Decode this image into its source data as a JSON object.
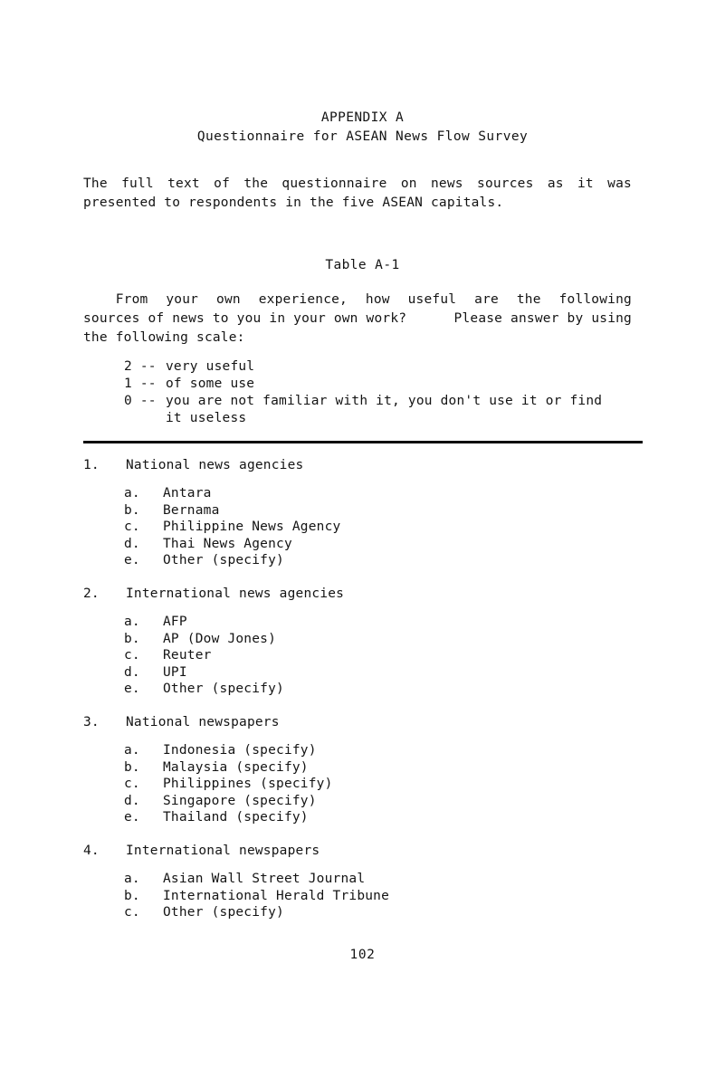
{
  "document": {
    "appendix_title": "APPENDIX A",
    "appendix_subtitle": "Questionnaire for ASEAN News Flow Survey",
    "intro": {
      "line1_words": [
        "The",
        "full",
        "text",
        "of",
        "the",
        "questionnaire",
        "on",
        "news",
        "sources",
        "as",
        "it",
        "was"
      ],
      "line2": "presented to respondents in the five ASEAN capitals."
    },
    "table_heading": "Table A-1",
    "prompt": {
      "line1_words": [
        "From",
        "your",
        "own",
        "experience,",
        "how",
        "useful",
        "are",
        "the",
        "following"
      ],
      "line2_words": [
        "sources of news to you in your own work?",
        "Please answer by using"
      ],
      "line3": "the following scale:"
    },
    "scale": [
      {
        "key": "2 --",
        "text": "very useful"
      },
      {
        "key": "1 --",
        "text": "of some use"
      },
      {
        "key": "0 --",
        "text": "you are not familiar with it, you don't use it or find",
        "continuation": "it useless"
      }
    ],
    "questions": [
      {
        "number": "1.",
        "title": "National news agencies",
        "items": [
          {
            "letter": "a.",
            "label": "Antara"
          },
          {
            "letter": "b.",
            "label": "Bernama"
          },
          {
            "letter": "c.",
            "label": "Philippine News Agency"
          },
          {
            "letter": "d.",
            "label": "Thai News Agency"
          },
          {
            "letter": "e.",
            "label": "Other (specify)"
          }
        ]
      },
      {
        "number": "2.",
        "title": "International news agencies",
        "items": [
          {
            "letter": "a.",
            "label": "AFP"
          },
          {
            "letter": "b.",
            "label": "AP (Dow Jones)"
          },
          {
            "letter": "c.",
            "label": "Reuter"
          },
          {
            "letter": "d.",
            "label": "UPI"
          },
          {
            "letter": "e.",
            "label": "Other (specify)"
          }
        ]
      },
      {
        "number": "3.",
        "title": "National newspapers",
        "items": [
          {
            "letter": "a.",
            "label": "Indonesia (specify)"
          },
          {
            "letter": "b.",
            "label": "Malaysia (specify)"
          },
          {
            "letter": "c.",
            "label": "Philippines (specify)"
          },
          {
            "letter": "d.",
            "label": "Singapore (specify)"
          },
          {
            "letter": "e.",
            "label": "Thailand (specify)"
          }
        ]
      },
      {
        "number": "4.",
        "title": "International newspapers",
        "items": [
          {
            "letter": "a.",
            "label": "Asian Wall Street Journal"
          },
          {
            "letter": "b.",
            "label": "International Herald Tribune"
          },
          {
            "letter": "c.",
            "label": "Other (specify)"
          }
        ]
      }
    ],
    "page_number": "102"
  }
}
